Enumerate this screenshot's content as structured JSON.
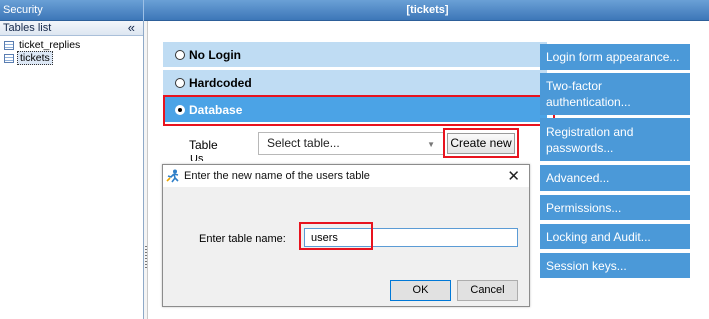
{
  "top_bar": {
    "left_title": "Security",
    "center_title": "[tickets]"
  },
  "tables_panel": {
    "header": "Tables list",
    "collapse_glyph": "«",
    "items": [
      {
        "label": "ticket_replies",
        "selected": false
      },
      {
        "label": "tickets",
        "selected": true
      }
    ]
  },
  "login_options": [
    {
      "label": "No Login",
      "checked": false
    },
    {
      "label": "Hardcoded",
      "checked": false
    },
    {
      "label": "Database",
      "checked": true
    }
  ],
  "table_field": {
    "label": "Table",
    "value": "Select table...",
    "create_label": "Create new"
  },
  "side_buttons": [
    {
      "label": "Login form appearance..."
    },
    {
      "label": "Two-factor authentication..."
    },
    {
      "label": "Registration and passwords..."
    },
    {
      "label": "Advanced..."
    },
    {
      "label": "Permissions..."
    },
    {
      "label": "Locking and Audit..."
    },
    {
      "label": "Session keys..."
    }
  ],
  "dialog": {
    "title": "Enter the new name of the users table",
    "close_glyph": "✕",
    "field_label": "Enter table name:",
    "field_value": "users",
    "ok_label": "OK",
    "cancel_label": "Cancel"
  },
  "colors": {
    "accent": "#4b99d8",
    "selected_option": "#4ba3e6",
    "option_bg": "#bfdcf3",
    "highlight_box": "#e8131e"
  }
}
